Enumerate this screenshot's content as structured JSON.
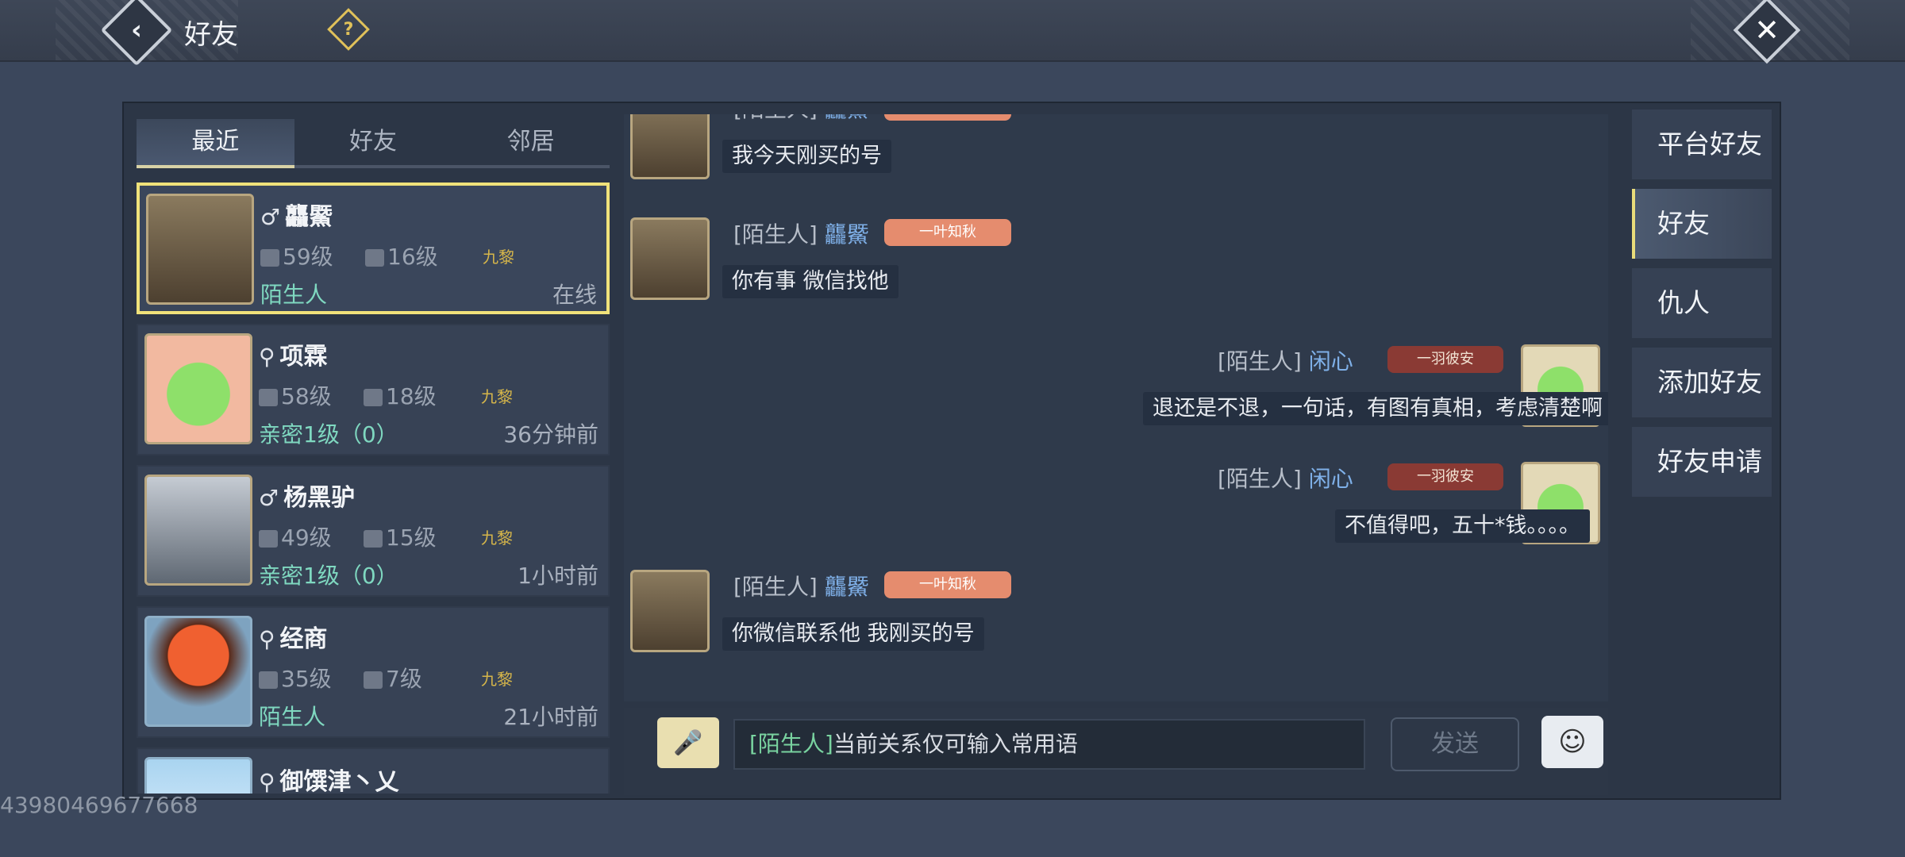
{
  "header": {
    "title": "好友",
    "back_icon": "‹",
    "help_icon": "?",
    "close_icon": "✕"
  },
  "tabs": [
    {
      "label": "最近",
      "active": true
    },
    {
      "label": "好友",
      "active": false
    },
    {
      "label": "邻居",
      "active": false
    }
  ],
  "friends": [
    {
      "gender": "♂",
      "name": "龘鱀",
      "level": "59级",
      "level2": "16级",
      "faction": "九黎",
      "relation": "陌生人",
      "time": "在线",
      "selected": true
    },
    {
      "gender": "⚲",
      "name": "项霖",
      "level": "58级",
      "level2": "18级",
      "faction": "九黎",
      "relation": "亲密1级（0）",
      "time": "36分钟前",
      "selected": false
    },
    {
      "gender": "♂",
      "name": "杨黑驴",
      "level": "49级",
      "level2": "15级",
      "faction": "九黎",
      "relation": "亲密1级（0）",
      "time": "1小时前",
      "selected": false
    },
    {
      "gender": "⚲",
      "name": "经商",
      "level": "35级",
      "level2": "7级",
      "faction": "九黎",
      "relation": "陌生人",
      "time": "21小时前",
      "selected": false
    },
    {
      "gender": "⚲",
      "name": "御馔津丶乂",
      "level": "",
      "level2": "",
      "faction": "",
      "relation": "",
      "time": "",
      "selected": false
    }
  ],
  "messages": [
    {
      "side": "left",
      "tag": "[陌生人]",
      "name": "龘鱀",
      "badge": "一叶知秋",
      "text": "我今天刚买的号"
    },
    {
      "side": "left",
      "tag": "[陌生人]",
      "name": "龘鱀",
      "badge": "一叶知秋",
      "text": "你有事 微信找他"
    },
    {
      "side": "right",
      "tag": "[陌生人]",
      "name": "闲心",
      "badge": "一羽彼安",
      "text": "退还是不退，一句话，有图有真相，考虑清楚啊"
    },
    {
      "side": "right",
      "tag": "[陌生人]",
      "name": "闲心",
      "badge": "一羽彼安",
      "text": "不值得吧，五十*钱。。。。"
    },
    {
      "side": "left",
      "tag": "[陌生人]",
      "name": "龘鱀",
      "badge": "一叶知秋",
      "text": "你微信联系他 我刚买的号"
    }
  ],
  "input": {
    "tag": "[陌生人]",
    "text": "当前关系仅可输入常用语",
    "send_label": "发送"
  },
  "side_menu": [
    {
      "label": "平台好友",
      "active": false
    },
    {
      "label": "好友",
      "active": true
    },
    {
      "label": "仇人",
      "active": false
    },
    {
      "label": "添加好友",
      "active": false
    },
    {
      "label": "好友申请",
      "active": false
    }
  ],
  "watermark": "43980469677668",
  "colors": {
    "accent_yellow": "#f0e27a",
    "relation_green": "#7fd8c0",
    "name_blue": "#7fb0e8",
    "faction_gold": "#d6b64a"
  }
}
